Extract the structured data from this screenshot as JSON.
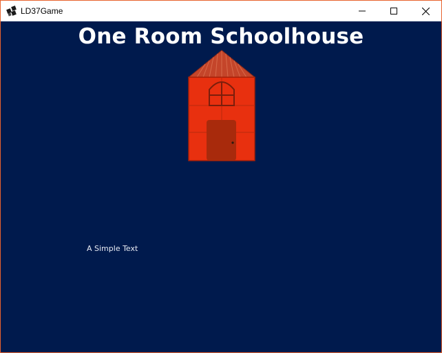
{
  "window": {
    "title": "LD37Game",
    "icon": "app-logo-icon",
    "buttons": {
      "minimize": "minimize-icon",
      "maximize": "maximize-icon",
      "close": "close-icon"
    }
  },
  "game": {
    "title": "One Room Schoolhouse",
    "caption": "A Simple Text",
    "colors": {
      "background": "#001a4d",
      "building": "#e8300f",
      "roof": "#c4452a",
      "door": "#a82a0c",
      "title_text": "#ffffff"
    }
  }
}
